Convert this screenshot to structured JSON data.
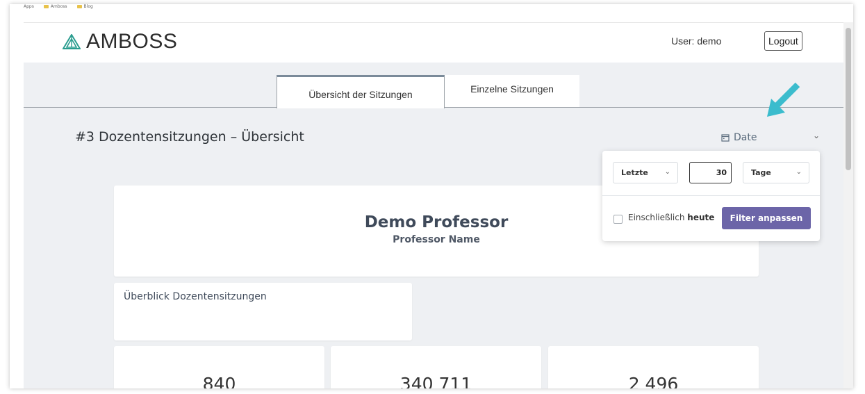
{
  "bookmarks": [
    "Apps",
    "Amboss",
    "Blog"
  ],
  "header": {
    "logo_text": "AMBOSS",
    "user_label": "User: demo",
    "logout_label": "Logout"
  },
  "tabs": [
    {
      "label": "Übersicht der Sitzungen",
      "active": true
    },
    {
      "label": "Einzelne Sitzungen",
      "active": false
    }
  ],
  "page": {
    "title": "#3 Dozentensitzungen – Übersicht",
    "date_filter_label": "Date"
  },
  "date_filter_popover": {
    "period_select": "Letzte",
    "amount": "30",
    "unit_select": "Tage",
    "include_today_prefix": "Einschließlich",
    "include_today_bold": "heute",
    "apply_button": "Filter anpassen"
  },
  "professor_card": {
    "name": "Demo Professor",
    "subtitle": "Professor Name"
  },
  "overview_card": {
    "title": "Überblick Dozentensitzungen"
  },
  "stats": [
    "840",
    "340 711",
    "2 496"
  ],
  "colors": {
    "accent_arrow": "#3bbccd",
    "filter_button": "#6c65a8",
    "content_bg": "#eef0f3",
    "logo_teal": "#2a9d8f"
  },
  "icons": {
    "calendar": "calendar-icon",
    "chevron": "chevron-down-icon",
    "logo": "amboss-logo-icon",
    "pointer_arrow": "arrow-icon"
  }
}
